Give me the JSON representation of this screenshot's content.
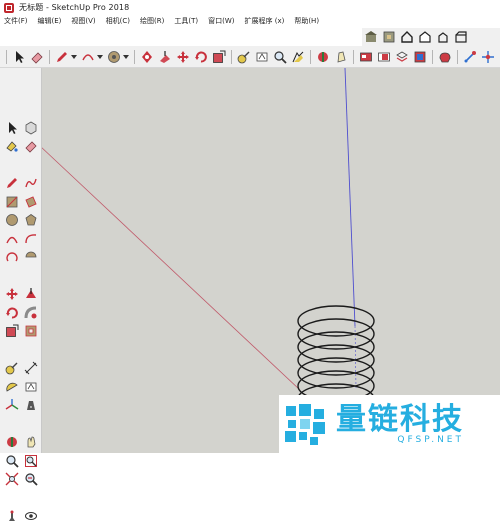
{
  "window": {
    "title": "无标题 - SketchUp Pro 2018"
  },
  "menu": [
    "文件(F)",
    "编辑(E)",
    "视图(V)",
    "相机(C)",
    "绘图(R)",
    "工具(T)",
    "窗口(W)",
    "扩展程序 (x)",
    "帮助(H)"
  ],
  "toolbar_top": {
    "icons": [
      "warehouse-icon",
      "component-icon",
      "home-view-icon",
      "front-view-icon",
      "top-view-icon",
      "side-view-icon"
    ]
  },
  "toolbar_main": {
    "icons": [
      "select-icon",
      "eraser-icon",
      "pencil-icon",
      "arc-icon",
      "paint-bucket-icon",
      "push-pull-icon",
      "move-icon",
      "pan-icon",
      "rotate-icon",
      "scale-icon",
      "tape-measure-icon",
      "text-icon",
      "zoom-icon",
      "zoom-extents-icon",
      "orbit-icon",
      "walk-icon",
      "section-icon",
      "styles-icon",
      "layers-icon",
      "materials-icon",
      "extension-icon",
      "add-location-icon",
      "geo-icon"
    ]
  },
  "left_toolbar": {
    "icons": [
      "select-tool-icon",
      "make-component-icon",
      "paint-tool-icon",
      "eraser-tool-icon",
      "line-tool-icon",
      "freehand-tool-icon",
      "rectangle-tool-icon",
      "rotated-rect-icon",
      "circle-tool-icon",
      "polygon-tool-icon",
      "arc-tool-icon",
      "two-point-arc-icon",
      "three-point-arc-icon",
      "pie-tool-icon",
      "move-tool-icon",
      "push-pull-tool-icon",
      "rotate-tool-icon",
      "follow-me-icon",
      "scale-tool-icon",
      "offset-tool-icon",
      "tape-tool-icon",
      "dimension-tool-icon",
      "protractor-icon",
      "text-tool-icon",
      "axes-tool-icon",
      "3d-text-icon",
      "orbit-tool-icon",
      "pan-tool-icon",
      "zoom-tool-icon",
      "zoom-window-icon",
      "zoom-extents-tool-icon",
      "previous-view-icon",
      "position-camera-icon",
      "look-around-icon"
    ]
  },
  "watermark": {
    "cn": "量链科技",
    "en": "QFSP.NET"
  },
  "colors": {
    "viewport": "#d3d3ce",
    "red_axis": "#c05a6a",
    "blue_axis": "#4f4fcf",
    "spring": "#1a1a1a",
    "watermark": "#25aee0"
  }
}
